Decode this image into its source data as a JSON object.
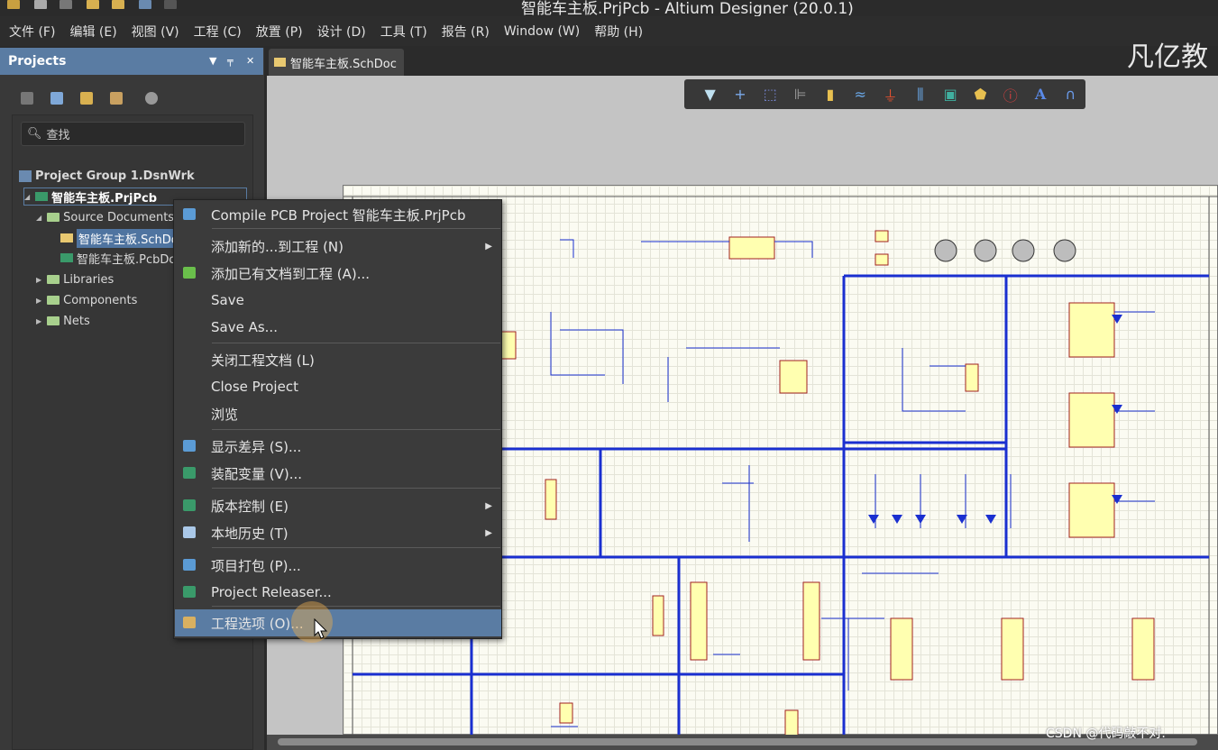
{
  "window": {
    "title": "智能车主板.PrjPcb - Altium Designer (20.0.1)"
  },
  "menubar": [
    "文件 (F)",
    "编辑 (E)",
    "视图 (V)",
    "工程 (C)",
    "放置 (P)",
    "设计 (D)",
    "工具 (T)",
    "报告 (R)",
    "Window (W)",
    "帮助 (H)"
  ],
  "panel": {
    "title": "Projects",
    "search_placeholder": "查找",
    "tree": {
      "group": "Project Group 1.DsnWrk",
      "project": "智能车主板.PrjPcb",
      "source": "Source Documents",
      "sch": "智能车主板.SchDoc",
      "pcb": "智能车主板.PcbDoc",
      "libraries": "Libraries",
      "components": "Components",
      "nets": "Nets"
    }
  },
  "tab": {
    "label": "智能车主板.SchDoc"
  },
  "toolbar_icons": [
    "filter-icon",
    "crosshair-icon",
    "select-rect-icon",
    "align-icon",
    "part-icon",
    "wire-icon",
    "ground-icon",
    "bus-icon",
    "sheet-symbol-icon",
    "port-icon",
    "directive-icon",
    "text-icon",
    "arc-icon"
  ],
  "context_menu": {
    "items": [
      {
        "label": "Compile PCB Project 智能车主板.PrjPcb",
        "icon": "compile-icon",
        "color": "#5b9bd5"
      },
      {
        "label": "添加新的...到工程 (N)",
        "submenu": true
      },
      {
        "label": "添加已有文档到工程 (A)...",
        "icon": "add-existing-icon",
        "color": "#6abf4b"
      },
      {
        "label": "Save"
      },
      {
        "label": "Save As..."
      },
      {
        "label": "关闭工程文档 (L)"
      },
      {
        "label": "Close Project"
      },
      {
        "label": "浏览"
      },
      {
        "label": "显示差异 (S)...",
        "icon": "diff-icon",
        "color": "#5b9bd5"
      },
      {
        "label": "装配变量 (V)...",
        "icon": "variant-icon",
        "color": "#3a9a6a"
      },
      {
        "label": "版本控制 (E)",
        "icon": "version-control-icon",
        "color": "#3a9a6a",
        "submenu": true
      },
      {
        "label": "本地历史 (T)",
        "icon": "history-icon",
        "color": "#aac8e8",
        "submenu": true
      },
      {
        "label": "项目打包 (P)...",
        "icon": "package-icon",
        "color": "#5b9bd5"
      },
      {
        "label": "Project Releaser...",
        "icon": "releaser-icon",
        "color": "#3a9a6a"
      },
      {
        "label": "工程选项 (O)...",
        "icon": "project-options-icon",
        "color": "#d9b060",
        "highlighted": true
      }
    ]
  },
  "watermark": "凡亿教",
  "csdn_watermark": "CSDN @代码敲不对.",
  "colors": {
    "accent": "#5a7ca3",
    "bus": "#1a2fd0",
    "panel": "#393939"
  }
}
